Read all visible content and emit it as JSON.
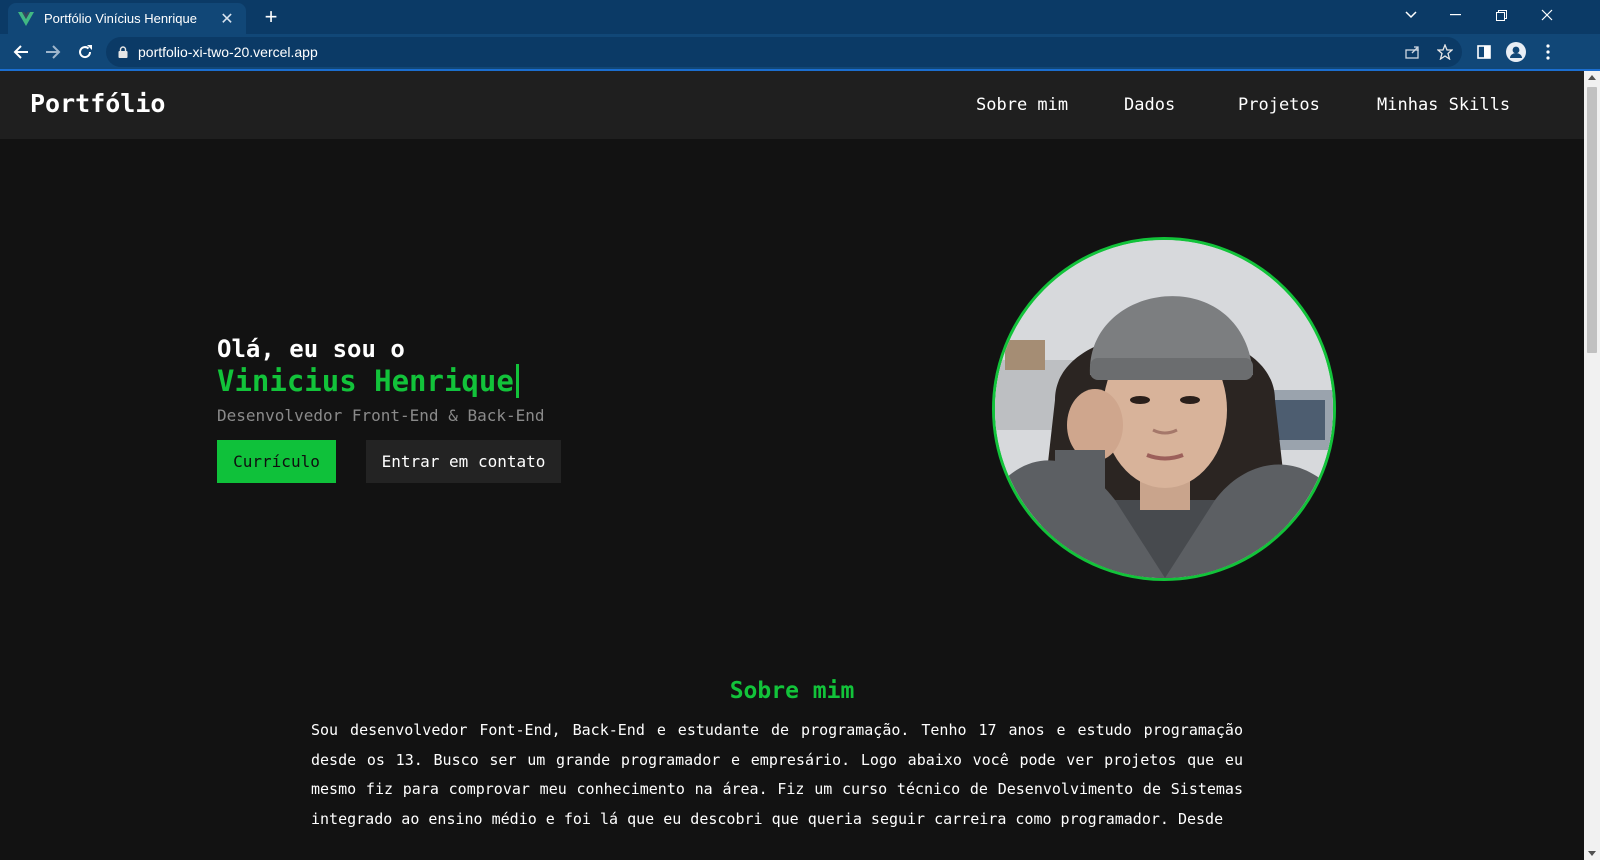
{
  "browser": {
    "tab_title": "Portfólio Vinícius Henrique",
    "url": "portfolio-xi-two-20.vercel.app",
    "accent_color": "#1b6ed0"
  },
  "site": {
    "logo": "Portfólio",
    "nav": [
      "Sobre mim",
      "Dados",
      "Projetos",
      "Minhas Skills"
    ],
    "brand_color": "#12c33a"
  },
  "hero": {
    "greeting": "Olá, eu sou o",
    "name": "Vinicius Henrique",
    "role": "Desenvolvedor Front-End & Back-End",
    "cv_button": "Currículo",
    "contact_button": "Entrar em contato"
  },
  "about": {
    "title": "Sobre mim",
    "text": "Sou desenvolvedor Font-End, Back-End e estudante de programação. Tenho 17 anos e estudo programação desde os 13. Busco ser um grande programador e empresário. Logo abaixo você pode ver projetos que eu mesmo fiz para comprovar meu conhecimento na área. Fiz um curso técnico de Desenvolvimento de Sistemas integrado ao ensino médio e foi lá que eu descobri que queria seguir carreira como programador. Desde"
  }
}
